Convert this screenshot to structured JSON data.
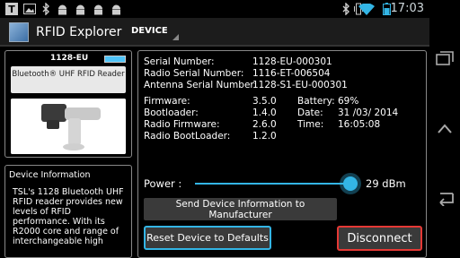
{
  "status_bar": {
    "time": "17:03",
    "left_icons": [
      "text-icon",
      "image-icon",
      "bluetooth-icon",
      "android-icon",
      "android-icon",
      "android-icon",
      "android-icon"
    ],
    "right_icons": [
      "bluetooth-icon",
      "vibrate-icon",
      "wifi-icon",
      "battery-icon"
    ]
  },
  "action_bar": {
    "title": "RFID Explorer",
    "tab": "DEVICE"
  },
  "device_card": {
    "model": "1128-EU",
    "product_name": "Bluetooth® UHF RFID Reader"
  },
  "device_info": {
    "heading": "Device Information",
    "text": "TSL's 1128 Bluetooth UHF RFID reader provides new levels of RFID performance. With its R2000 core and range of interchangeable high"
  },
  "details": {
    "serial_number": {
      "label": "Serial Number:",
      "value": "1128-EU-000301"
    },
    "radio_serial_number": {
      "label": "Radio Serial Number:",
      "value": "1116-ET-006504"
    },
    "antenna_serial_number": {
      "label": "Antenna Serial Number:",
      "value": "1128-S1-EU-000301"
    },
    "firmware": {
      "label": "Firmware:",
      "value": "3.5.0"
    },
    "bootloader": {
      "label": "Bootloader:",
      "value": "1.4.0"
    },
    "radio_firmware": {
      "label": "Radio Firmware:",
      "value": "2.6.0"
    },
    "radio_bootloader": {
      "label": "Radio BootLoader:",
      "value": "1.2.0"
    },
    "battery": {
      "label": "Battery:",
      "value": "69%"
    },
    "date": {
      "label": "Date:",
      "value": "31 /03/ 2014"
    },
    "time": {
      "label": "Time:",
      "value": "16:05:08"
    }
  },
  "power": {
    "label": "Power :",
    "value": "29 dBm",
    "slider_fraction": 0.97
  },
  "buttons": {
    "send_info": "Send Device Information to Manufacturer",
    "reset": "Reset Device to Defaults",
    "disconnect": "Disconnect"
  },
  "colors": {
    "accent": "#33b5e5",
    "disconnect_border": "#e53935",
    "background": "#000000"
  }
}
